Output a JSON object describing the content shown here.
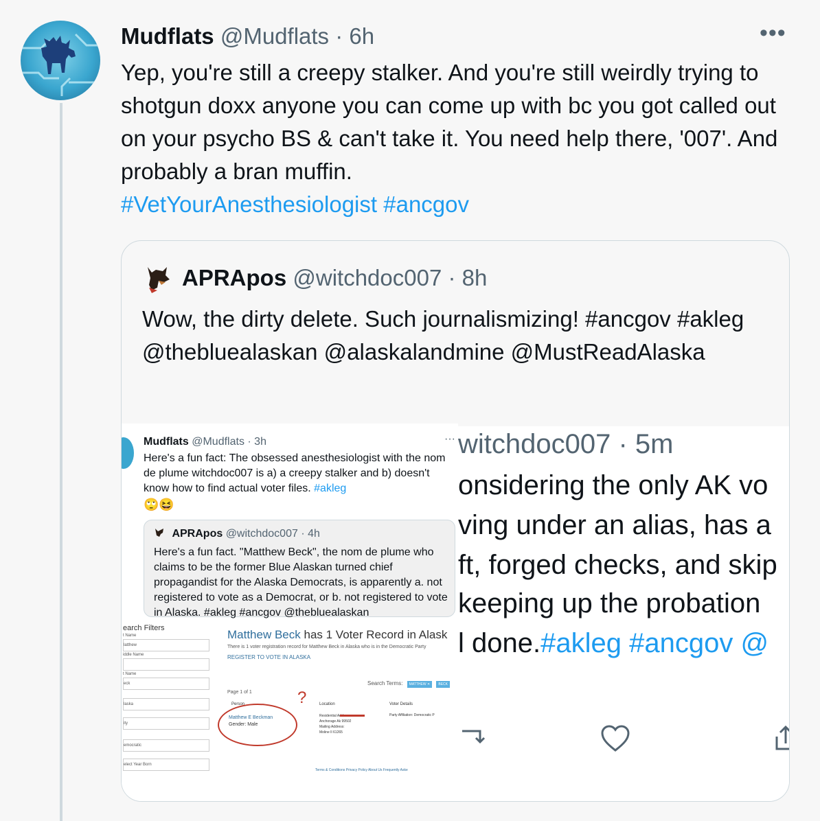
{
  "tweet": {
    "author_name": "Mudflats",
    "author_handle": "@Mudflats",
    "separator": "·",
    "time": "6h",
    "more_label": "•••",
    "text": "Yep, you're still a creepy stalker. And you're still weirdly trying to shotgun doxx anyone you can come up with bc you got called out on your psycho BS & can't take it. You need help there, '007'. And probably a bran muffin.",
    "hashtags": [
      "#VetYourAnesthesiologist",
      "#ancgov"
    ]
  },
  "quote": {
    "author_name": "APRApos",
    "author_handle": "@witchdoc007",
    "separator": "·",
    "time": "8h",
    "text": "Wow, the dirty delete. Such journalismizing! #ancgov #akleg @thebluealaskan @alaskalandmine @MustReadAlaska"
  },
  "screenshot_left": {
    "author_name": "Mudflats",
    "author_handle": "@Mudflats · 3h",
    "more": "···",
    "text": "Here's a fun fact: The obsessed anesthesiologist with the nom de plume witchdoc007 is a) a creepy stalker and b) doesn't know how to find actual voter files.",
    "tag": "#akleg",
    "emoji": "🙄😆",
    "inner": {
      "author_name": "APRApos",
      "author_handle": "@witchdoc007 · 4h",
      "text": "Here's a fun fact.  \"Matthew Beck\", the nom de plume who claims to be the former Blue Alaskan turned chief propagandist for the Alaska Democrats, is apparently a. not registered to vote as a Democrat, or b. not registered to vote in Alaska. #akleg #ancgov @thebluealaskan"
    },
    "voter": {
      "filters_title": "earch Filters",
      "fields": [
        {
          "label": "t Name",
          "value": "latthew"
        },
        {
          "label": "iddle Name",
          "value": ""
        },
        {
          "label": "t Name",
          "value": "eck"
        },
        {
          "label": "",
          "value": "laska"
        },
        {
          "label": "",
          "value": "ity"
        },
        {
          "label": "",
          "value": "emocratic"
        },
        {
          "label": "",
          "value": "elect Year Born"
        }
      ],
      "title_name": "Matthew Beck",
      "title_rest": " has 1 Voter Record in Alask",
      "subtitle": "There is 1 voter registration record for Matthew Beck in Alaska who is in the Democratic Party",
      "register_link": "REGISTER TO VOTE IN ALASKA",
      "search_terms": "Search Terms:",
      "chips": [
        "MATTHEW ✕",
        "BECK"
      ],
      "page": "Page 1 of 1",
      "headers": [
        "Person",
        "Location",
        "Voter Details"
      ],
      "person_name": "Matthew E Beckman",
      "person_gender": "Gender: Male",
      "location_lines": [
        "Residential Address:",
        "Anchorage Ak 99502",
        "Mailing Address:",
        "Moline Il 61265"
      ],
      "affiliation": "Party Affiliation: Democratic P",
      "footer": "Terms & Conditions   Privacy Policy   About Us   Frequently Aske"
    }
  },
  "screenshot_right": {
    "meta_line": "witchdoc007 · 5m",
    "lines": [
      "onsidering the only AK vo",
      "ving under an alias, has a",
      "ft, forged checks, and skip",
      " keeping up the probation"
    ],
    "last_prefix": "l done.",
    "last_tags": "#akleg #ancgov @"
  }
}
